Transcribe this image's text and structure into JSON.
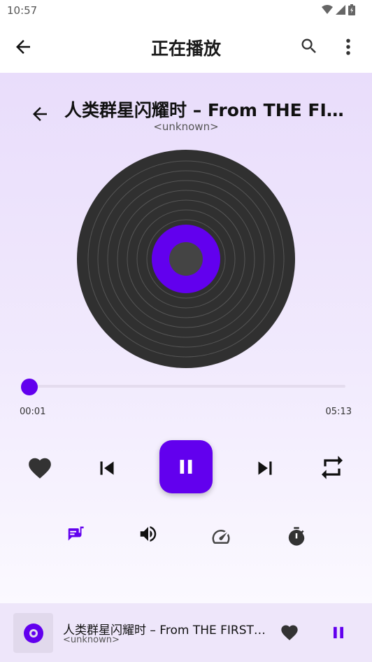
{
  "status_bar": {
    "time": "10:57",
    "icons": [
      "wifi-icon",
      "signal-icon",
      "battery-icon"
    ]
  },
  "app_bar": {
    "title": "正在播放",
    "icons": [
      "back-arrow-icon",
      "search-icon",
      "more-vert-icon"
    ]
  },
  "player": {
    "song_title": "人类群星闪耀时 – From THE FIRST TAKE",
    "artist": "<unknown>",
    "current_time": "00:01",
    "total_time": "05:13",
    "progress": 0.003,
    "controls": [
      "favorite-icon",
      "skip-previous-icon",
      "pause-icon",
      "skip-next-icon",
      "repeat-icon"
    ],
    "extras": [
      "lyrics-icon",
      "volume-icon",
      "speed-icon",
      "timer-icon"
    ]
  },
  "mini_player": {
    "title": "人类群星闪耀时 – From THE FIRST TAKE",
    "artist": "<unknown>"
  },
  "colors": {
    "accent": "#6200ee",
    "vinyl": "#303030",
    "background_top": "#e9ddfb",
    "mini_player_bg": "#eee6fa"
  }
}
